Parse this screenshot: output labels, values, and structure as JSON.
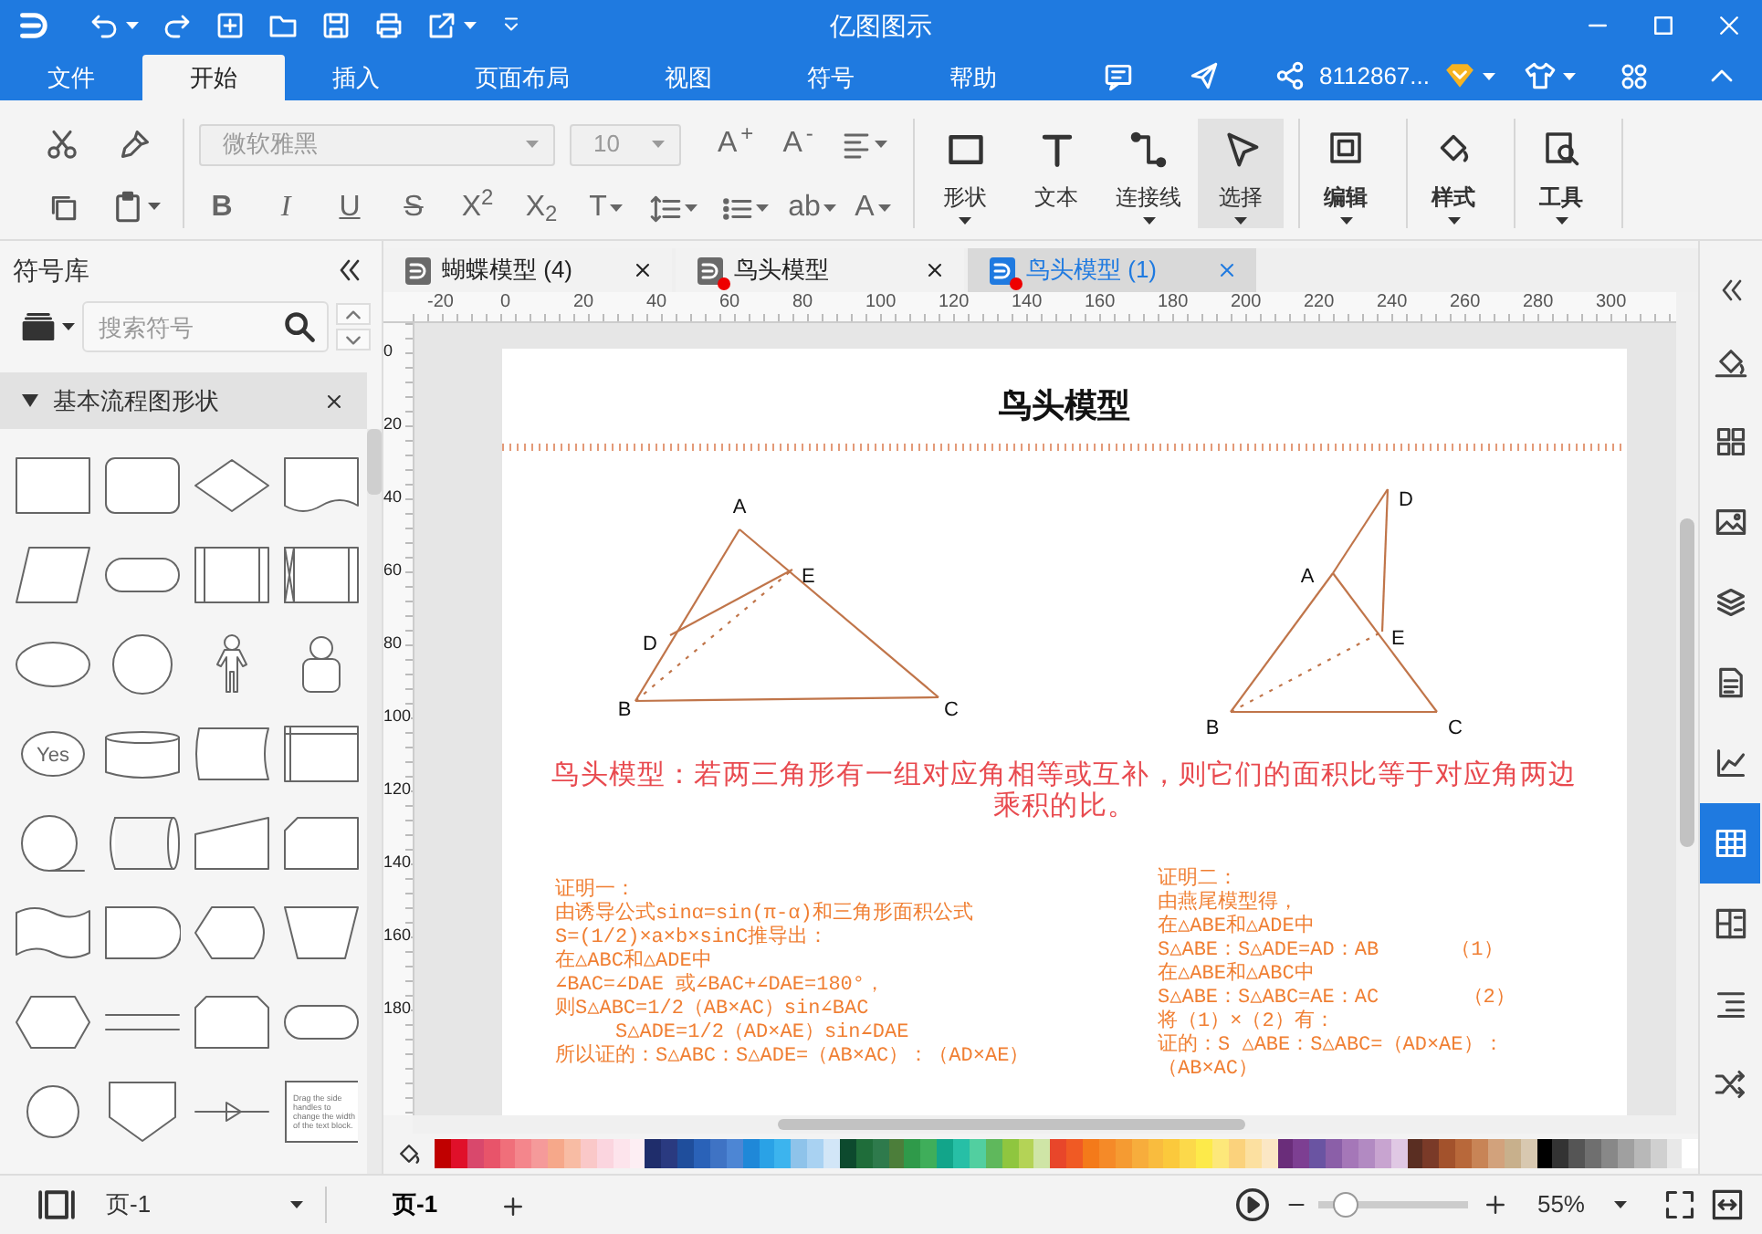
{
  "window": {
    "title": "亿图图示"
  },
  "menu_tabs": [
    {
      "label": "文件",
      "selected": false
    },
    {
      "label": "开始",
      "selected": true
    },
    {
      "label": "插入",
      "selected": false
    },
    {
      "label": "页面布局",
      "selected": false
    },
    {
      "label": "视图",
      "selected": false
    },
    {
      "label": "符号",
      "selected": false
    },
    {
      "label": "帮助",
      "selected": false
    }
  ],
  "account": {
    "user": "8112867..."
  },
  "ribbon": {
    "font_family": {
      "value": "微软雅黑",
      "disabled": true
    },
    "font_size": {
      "value": "10",
      "disabled": true
    },
    "font_buttons": [
      {
        "kind": "grow",
        "label": "A$^{+}$"
      },
      {
        "kind": "shrink",
        "label": "A$^{-}$"
      },
      {
        "kind": "align"
      }
    ],
    "format_buttons": [
      {
        "kind": "bold",
        "label": "B"
      },
      {
        "kind": "italic",
        "label": "I"
      },
      {
        "kind": "underline",
        "label": "U"
      },
      {
        "kind": "strike",
        "label": "S"
      },
      {
        "kind": "superscript",
        "label": "X$^{2}$"
      },
      {
        "kind": "subscript",
        "label": "X$_{2}$"
      },
      {
        "kind": "text",
        "label": "T",
        "dropdown": true
      },
      {
        "kind": "line-spacing",
        "dropdown": true
      },
      {
        "kind": "list",
        "dropdown": true
      },
      {
        "kind": "text",
        "label": "ab",
        "dropdown": true
      },
      {
        "kind": "text",
        "label": "A",
        "dropdown": true
      }
    ],
    "tools": [
      {
        "kind": "shape",
        "label": "形状",
        "selected": false,
        "dropdown": true
      },
      {
        "kind": "text",
        "label": "文本",
        "selected": false,
        "dropdown": false
      },
      {
        "kind": "connector",
        "label": "连接线",
        "selected": false,
        "dropdown": true
      },
      {
        "kind": "select",
        "label": "选择",
        "selected": true,
        "dropdown": true
      }
    ],
    "panels": [
      {
        "kind": "edit",
        "label": "编辑"
      },
      {
        "kind": "style",
        "label": "样式"
      },
      {
        "kind": "tools",
        "label": "工具"
      }
    ]
  },
  "library": {
    "title": "符号库",
    "search_placeholder": "搜索符号",
    "section": {
      "title": "基本流程图形状",
      "expanded": true,
      "shapes": [
        {
          "kind": "process"
        },
        {
          "kind": "rounded"
        },
        {
          "kind": "diamond"
        },
        {
          "kind": "document"
        },
        {
          "kind": "parallelogram"
        },
        {
          "kind": "terminator"
        },
        {
          "kind": "predefined"
        },
        {
          "kind": "predefined-x"
        },
        {
          "kind": "ellipse"
        },
        {
          "kind": "circle"
        },
        {
          "kind": "actor"
        },
        {
          "kind": "user"
        },
        {
          "kind": "ellipse-label",
          "label": "Yes"
        },
        {
          "kind": "cylinder"
        },
        {
          "kind": "card-curved"
        },
        {
          "kind": "internal-storage"
        },
        {
          "kind": "circle-underline"
        },
        {
          "kind": "drum"
        },
        {
          "kind": "manual-input"
        },
        {
          "kind": "chamfer"
        },
        {
          "kind": "tape"
        },
        {
          "kind": "delay"
        },
        {
          "kind": "display"
        },
        {
          "kind": "trapezoid"
        },
        {
          "kind": "hexagon"
        },
        {
          "kind": "parallel-lines"
        },
        {
          "kind": "loop-limit"
        },
        {
          "kind": "terminator"
        },
        {
          "kind": "small-circle"
        },
        {
          "kind": "offpage"
        },
        {
          "kind": "arrow-line"
        },
        {
          "kind": "text-block",
          "label": "Drag the side handles to change the width of the text block."
        }
      ]
    }
  },
  "documents": [
    {
      "label": "蝴蝶模型 (4)",
      "modified": false,
      "selected": false
    },
    {
      "label": "鸟头模型",
      "modified": true,
      "selected": false
    },
    {
      "label": "鸟头模型 (1)",
      "modified": true,
      "selected": true
    }
  ],
  "ruler": {
    "horizontal": [
      "-20",
      "0",
      "20",
      "40",
      "60",
      "80",
      "100",
      "120",
      "140",
      "160",
      "180",
      "200",
      "220",
      "240",
      "260",
      "280",
      "300"
    ],
    "vertical": [
      "0",
      "20",
      "40",
      "60",
      "80",
      "100",
      "120",
      "140",
      "160",
      "180"
    ]
  },
  "page": {
    "title": "鸟头模型",
    "figures": [
      {
        "points": [
          {
            "label": "A"
          },
          {
            "label": "B"
          },
          {
            "label": "C"
          },
          {
            "label": "D"
          },
          {
            "label": "E"
          }
        ]
      },
      {
        "points": [
          {
            "label": "A"
          },
          {
            "label": "B"
          },
          {
            "label": "C"
          },
          {
            "label": "D"
          },
          {
            "label": "E"
          }
        ]
      }
    ],
    "caption": "鸟头模型：若两三角形有一组对应角相等或互补，则它们的面积比等于对应角两边乘积的比。",
    "proofs": [
      {
        "lines": [
          "证明一：",
          "由诱导公式sinα=sin(π-α)和三角形面积公式",
          "S=(1/2)×a×b×sinC推导出：",
          "在△ABC和△ADE中",
          "∠BAC=∠DAE 或∠BAC+∠DAE=180°，",
          "则S△ABC=1/2（AB×AC）sin∠BAC",
          "     S△ADE=1/2（AD×AE）sin∠DAE",
          "所以证的：S△ABC：S△ADE=（AB×AC）：（AD×AE）"
        ]
      },
      {
        "lines": [
          "证明二：",
          "由燕尾模型得，",
          "在△ABE和△ADE中",
          "S△ABE：S△ADE=AD：AB      （1）",
          "在△ABE和△ABC中",
          "S△ABE：S△ABC=AE：AC       （2）",
          "将（1）×（2）有：",
          "证的：S △ABE：S△ABC=（AD×AE）：",
          "（AB×AC）"
        ]
      }
    ]
  },
  "palette": [
    {
      "color": "#c00000"
    },
    {
      "color": "#e0102a"
    },
    {
      "color": "#d9486c"
    },
    {
      "color": "#e8546a"
    },
    {
      "color": "#f06f7a"
    },
    {
      "color": "#f4868c"
    },
    {
      "color": "#f59a9a"
    },
    {
      "color": "#f6a88a"
    },
    {
      "color": "#f8bca4"
    },
    {
      "color": "#fac8c8"
    },
    {
      "color": "#fbd5df"
    },
    {
      "color": "#fde4ec"
    },
    {
      "color": "#fdeef3"
    },
    {
      "color": "#1f2d6b"
    },
    {
      "color": "#2a3a80"
    },
    {
      "color": "#1f4e9c"
    },
    {
      "color": "#2a62b8"
    },
    {
      "color": "#3f73c4"
    },
    {
      "color": "#4d86d4"
    },
    {
      "color": "#1f88d8"
    },
    {
      "color": "#2aa2e6"
    },
    {
      "color": "#3cb4ee"
    },
    {
      "color": "#8ec3ea"
    },
    {
      "color": "#a9d2f2"
    },
    {
      "color": "#d2e6f7"
    },
    {
      "color": "#0d4a2e"
    },
    {
      "color": "#1f6d3a"
    },
    {
      "color": "#2e7a4c"
    },
    {
      "color": "#4c7e3a"
    },
    {
      "color": "#2f9a4a"
    },
    {
      "color": "#3fae5a"
    },
    {
      "color": "#12a58a"
    },
    {
      "color": "#27bfa6"
    },
    {
      "color": "#52cfa0"
    },
    {
      "color": "#5fb85c"
    },
    {
      "color": "#8fc63f"
    },
    {
      "color": "#b4d356"
    },
    {
      "color": "#cfe5a6"
    },
    {
      "color": "#e8462a"
    },
    {
      "color": "#f05a24"
    },
    {
      "color": "#f47a1a"
    },
    {
      "color": "#f58a28"
    },
    {
      "color": "#f59b32"
    },
    {
      "color": "#f7ad3c"
    },
    {
      "color": "#f9bc3e"
    },
    {
      "color": "#fbc93c"
    },
    {
      "color": "#fcd94a"
    },
    {
      "color": "#fdea4a"
    },
    {
      "color": "#fde87a"
    },
    {
      "color": "#fbd27c"
    },
    {
      "color": "#fce0a0"
    },
    {
      "color": "#fbe7c4"
    },
    {
      "color": "#6a2d7a"
    },
    {
      "color": "#7d3f92"
    },
    {
      "color": "#6a54a2"
    },
    {
      "color": "#8b5fa8"
    },
    {
      "color": "#a577b8"
    },
    {
      "color": "#b28ac2"
    },
    {
      "color": "#c8a4d0"
    },
    {
      "color": "#e0c8e4"
    },
    {
      "color": "#5a2e22"
    },
    {
      "color": "#7a3a28"
    },
    {
      "color": "#a3522c"
    },
    {
      "color": "#b8683a"
    },
    {
      "color": "#c88456"
    },
    {
      "color": "#d2a27c"
    },
    {
      "color": "#c8b08c"
    },
    {
      "color": "#d8c8b0"
    },
    {
      "color": "#000000"
    },
    {
      "color": "#333333"
    },
    {
      "color": "#555555"
    },
    {
      "color": "#6f6f6f"
    },
    {
      "color": "#888888"
    },
    {
      "color": "#a0a0a0"
    },
    {
      "color": "#b8b8b8"
    },
    {
      "color": "#d0d0d0"
    },
    {
      "color": "#e8e8e8"
    },
    {
      "color": "#ffffff"
    }
  ],
  "side_tools": [
    {
      "kind": "fill",
      "selected": false
    },
    {
      "kind": "shapes",
      "selected": false
    },
    {
      "kind": "image",
      "selected": false
    },
    {
      "kind": "layers",
      "selected": false
    },
    {
      "kind": "page",
      "selected": false
    },
    {
      "kind": "chart",
      "selected": false
    },
    {
      "kind": "table",
      "selected": true
    },
    {
      "kind": "layout",
      "selected": false
    },
    {
      "kind": "outline",
      "selected": false
    },
    {
      "kind": "shuffle",
      "selected": false
    }
  ],
  "status": {
    "page_select": "页-1",
    "pages": [
      {
        "label": "页-1",
        "selected": true
      }
    ],
    "zoom": {
      "level": 0.18,
      "reading": "55%"
    }
  }
}
